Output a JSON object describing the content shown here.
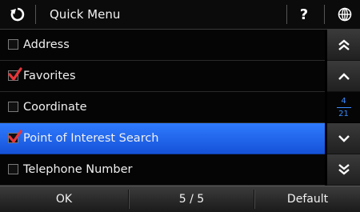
{
  "header": {
    "title": "Quick Menu",
    "back_icon": "refresh-back-icon",
    "help_label": "?",
    "globe_icon": "globe-icon"
  },
  "items": [
    {
      "label": "Address",
      "checked": false,
      "selected": false
    },
    {
      "label": "Favorites",
      "checked": true,
      "selected": false
    },
    {
      "label": "Coordinate",
      "checked": false,
      "selected": false
    },
    {
      "label": "Point of Interest Search",
      "checked": true,
      "selected": true
    },
    {
      "label": "Telephone Number",
      "checked": false,
      "selected": false
    }
  ],
  "scroll": {
    "page_current": "4",
    "page_total": "21",
    "icons": [
      "double-chevron-up-icon",
      "chevron-up-icon",
      "chevron-down-icon",
      "double-chevron-down-icon"
    ]
  },
  "footer": {
    "ok_label": "OK",
    "count_label": "5 / 5",
    "default_label": "Default"
  },
  "colors": {
    "selected_row": "#2466f0",
    "checkmark": "#e8363a",
    "pager_text": "#3a8cff"
  }
}
